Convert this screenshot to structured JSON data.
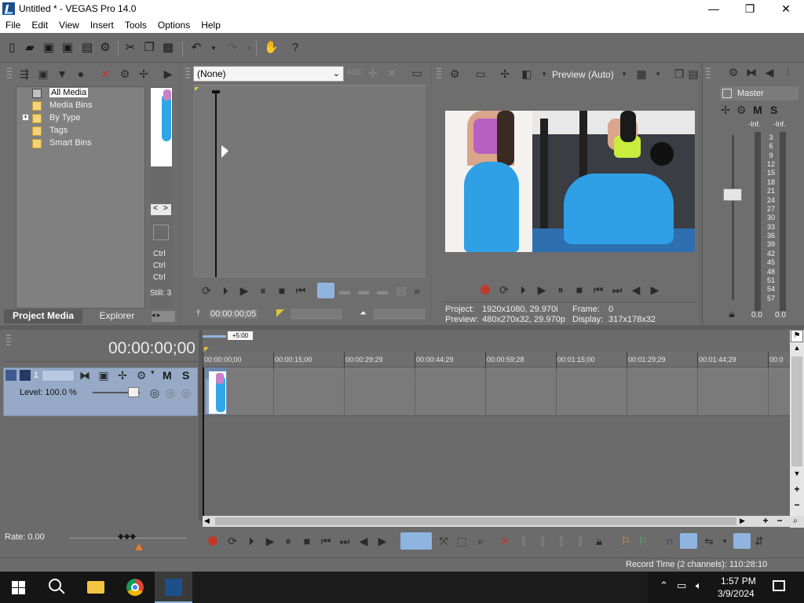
{
  "app": {
    "title": "Untitled * - VEGAS Pro 14.0"
  },
  "window_controls": {
    "minimize": "—",
    "maximize": "❐",
    "close": "✕"
  },
  "menu": [
    "File",
    "Edit",
    "View",
    "Insert",
    "Tools",
    "Options",
    "Help"
  ],
  "project_media": {
    "tree": [
      "All Media",
      "Media Bins",
      "By Type",
      "Tags",
      "Smart Bins"
    ],
    "expand_glyph": "+",
    "tabs": [
      "Project Media",
      "Explorer"
    ],
    "side_labels": [
      "Ctrl",
      "Ctrl",
      "Ctrl",
      "Still: 3"
    ],
    "nav": [
      "<",
      ">"
    ]
  },
  "trimmer": {
    "dropdown_value": "(None)",
    "timecode": "00:00:00;05"
  },
  "preview": {
    "quality": "Preview (Auto)",
    "project_label": "Project:",
    "project_value": "1920x1080, 29.970i",
    "preview_label": "Preview:",
    "preview_value": "480x270x32, 29.970p",
    "frame_label": "Frame:",
    "frame_value": "0",
    "display_label": "Display:",
    "display_value": "317x178x32"
  },
  "mixer": {
    "title": "Master",
    "mute": "M",
    "solo": "S",
    "inf_left": "-Inf.",
    "inf_right": "-Inf.",
    "scale": [
      "3",
      "6",
      "9",
      "12",
      "15",
      "18",
      "21",
      "24",
      "27",
      "30",
      "33",
      "36",
      "39",
      "42",
      "45",
      "48",
      "51",
      "54",
      "57"
    ],
    "value_left": "0.0",
    "value_right": "0.0"
  },
  "timeline": {
    "timecode": "00:00:00;00",
    "offset_badge": "+5:00",
    "track_number": "1",
    "mute": "M",
    "solo": "S",
    "level": "Level: 100.0 %",
    "ticks": [
      "00:00:00;00",
      "00:00:15;00",
      "00:00:29;29",
      "00:00:44;29",
      "00:00:59;28",
      "00:01:15;00",
      "00:01:29;29",
      "00:01:44;29",
      "00:0"
    ],
    "rate": "Rate: 0.00",
    "record_time": "Record Time (2 channels): 110:28:10"
  },
  "taskbar": {
    "time": "1:57 PM",
    "date": "3/9/2024"
  }
}
